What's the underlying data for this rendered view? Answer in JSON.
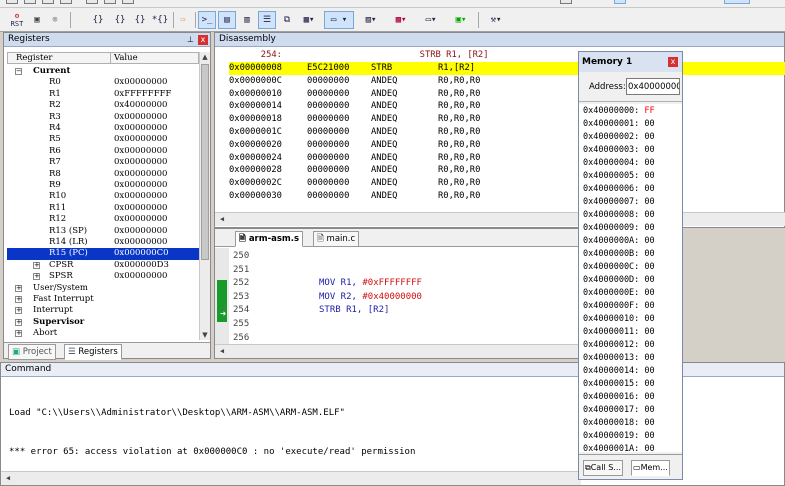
{
  "toolbar": {
    "row2_icons": [
      "rst-icon",
      "stop-icon",
      "step-into-icon",
      "step-over-icon",
      "step-out-icon",
      "run-to-cursor-icon",
      "show-next-statement-icon",
      "command-window-icon",
      "disassembly-window-icon",
      "symbols-window-icon",
      "registers-window-icon",
      "call-stack-icon",
      "watch-window-icon",
      "memory-window-icon",
      "serial-window-icon",
      "analysis-window-icon",
      "trace-window-icon",
      "system-viewer-icon",
      "toolbox-icon"
    ],
    "rst_label": "RST"
  },
  "registers": {
    "title": "Registers",
    "pin_glyph": "📌",
    "col_register": "Register",
    "col_value": "Value",
    "group": "Current",
    "rows": [
      {
        "name": "R0",
        "value": "0x00000000"
      },
      {
        "name": "R1",
        "value": "0xFFFFFFFF"
      },
      {
        "name": "R2",
        "value": "0x40000000"
      },
      {
        "name": "R3",
        "value": "0x00000000"
      },
      {
        "name": "R4",
        "value": "0x00000000"
      },
      {
        "name": "R5",
        "value": "0x00000000"
      },
      {
        "name": "R6",
        "value": "0x00000000"
      },
      {
        "name": "R7",
        "value": "0x00000000"
      },
      {
        "name": "R8",
        "value": "0x00000000"
      },
      {
        "name": "R9",
        "value": "0x00000000"
      },
      {
        "name": "R10",
        "value": "0x00000000"
      },
      {
        "name": "R11",
        "value": "0x00000000"
      },
      {
        "name": "R12",
        "value": "0x00000000"
      },
      {
        "name": "R13 (SP)",
        "value": "0x00000000"
      },
      {
        "name": "R14 (LR)",
        "value": "0x00000000"
      },
      {
        "name": "R15 (PC)",
        "value": "0x000000C0"
      },
      {
        "name": "CPSR",
        "value": "0x000000D3"
      },
      {
        "name": "SPSR",
        "value": "0x00000000"
      }
    ],
    "modes": [
      "User/System",
      "Fast Interrupt",
      "Interrupt",
      "Supervisor",
      "Abort"
    ],
    "bottom_tabs": [
      "Project",
      "Registers"
    ]
  },
  "disassembly": {
    "title": "Disassembly",
    "header": "      254:                          STRB R1, [R2]",
    "rows": [
      {
        "addr": "0x00000008",
        "code": "E5C21000",
        "mn": "STRB",
        "ops": "R1,[R2]"
      },
      {
        "addr": "0x0000000C",
        "code": "00000000",
        "mn": "ANDEQ",
        "ops": "R0,R0,R0"
      },
      {
        "addr": "0x00000010",
        "code": "00000000",
        "mn": "ANDEQ",
        "ops": "R0,R0,R0"
      },
      {
        "addr": "0x00000014",
        "code": "00000000",
        "mn": "ANDEQ",
        "ops": "R0,R0,R0"
      },
      {
        "addr": "0x00000018",
        "code": "00000000",
        "mn": "ANDEQ",
        "ops": "R0,R0,R0"
      },
      {
        "addr": "0x0000001C",
        "code": "00000000",
        "mn": "ANDEQ",
        "ops": "R0,R0,R0"
      },
      {
        "addr": "0x00000020",
        "code": "00000000",
        "mn": "ANDEQ",
        "ops": "R0,R0,R0"
      },
      {
        "addr": "0x00000024",
        "code": "00000000",
        "mn": "ANDEQ",
        "ops": "R0,R0,R0"
      },
      {
        "addr": "0x00000028",
        "code": "00000000",
        "mn": "ANDEQ",
        "ops": "R0,R0,R0"
      },
      {
        "addr": "0x0000002C",
        "code": "00000000",
        "mn": "ANDEQ",
        "ops": "R0,R0,R0"
      },
      {
        "addr": "0x00000030",
        "code": "00000000",
        "mn": "ANDEQ",
        "ops": "R0,R0,R0"
      }
    ]
  },
  "editor": {
    "tabs": [
      "arm-asm.s",
      "main.c"
    ],
    "lines": [
      {
        "num": "250",
        "code": ""
      },
      {
        "num": "251",
        "code": ""
      },
      {
        "num": "252",
        "code": "MOV R1, ",
        "hex": "#0xFFFFFFFF"
      },
      {
        "num": "253",
        "code": "MOV R2, ",
        "hex": "#0x40000000"
      },
      {
        "num": "254",
        "code": "STRB R1, [R2]"
      },
      {
        "num": "255",
        "code": ""
      },
      {
        "num": "256",
        "code": ""
      }
    ]
  },
  "command": {
    "title": "Command",
    "lines": [
      "Load \"C:\\\\Users\\\\Administrator\\\\Desktop\\\\ARM-ASM\\\\ARM-ASM.ELF\"",
      "*** error 65: access violation at 0x000000C0 : no 'execute/read' permission"
    ]
  },
  "memory": {
    "title": "Memory 1",
    "address_label": "Address:",
    "address_value": "0x40000000",
    "rows": [
      {
        "addr": "0x40000000:",
        "val": "FF"
      },
      {
        "addr": "0x40000001:",
        "val": "00"
      },
      {
        "addr": "0x40000002:",
        "val": "00"
      },
      {
        "addr": "0x40000003:",
        "val": "00"
      },
      {
        "addr": "0x40000004:",
        "val": "00"
      },
      {
        "addr": "0x40000005:",
        "val": "00"
      },
      {
        "addr": "0x40000006:",
        "val": "00"
      },
      {
        "addr": "0x40000007:",
        "val": "00"
      },
      {
        "addr": "0x40000008:",
        "val": "00"
      },
      {
        "addr": "0x40000009:",
        "val": "00"
      },
      {
        "addr": "0x4000000A:",
        "val": "00"
      },
      {
        "addr": "0x4000000B:",
        "val": "00"
      },
      {
        "addr": "0x4000000C:",
        "val": "00"
      },
      {
        "addr": "0x4000000D:",
        "val": "00"
      },
      {
        "addr": "0x4000000E:",
        "val": "00"
      },
      {
        "addr": "0x4000000F:",
        "val": "00"
      },
      {
        "addr": "0x40000010:",
        "val": "00"
      },
      {
        "addr": "0x40000011:",
        "val": "00"
      },
      {
        "addr": "0x40000012:",
        "val": "00"
      },
      {
        "addr": "0x40000013:",
        "val": "00"
      },
      {
        "addr": "0x40000014:",
        "val": "00"
      },
      {
        "addr": "0x40000015:",
        "val": "00"
      },
      {
        "addr": "0x40000016:",
        "val": "00"
      },
      {
        "addr": "0x40000017:",
        "val": "00"
      },
      {
        "addr": "0x40000018:",
        "val": "00"
      },
      {
        "addr": "0x40000019:",
        "val": "00"
      },
      {
        "addr": "0x4000001A:",
        "val": "00"
      }
    ],
    "bottom_tabs": [
      "Call S...",
      "Mem..."
    ]
  },
  "colors": {
    "current_line": "#ffff00",
    "selected_register": "#0a36c8",
    "changed_value": "#ff0000",
    "hex_literal": "#d01010",
    "code_text": "#1d1da8"
  }
}
